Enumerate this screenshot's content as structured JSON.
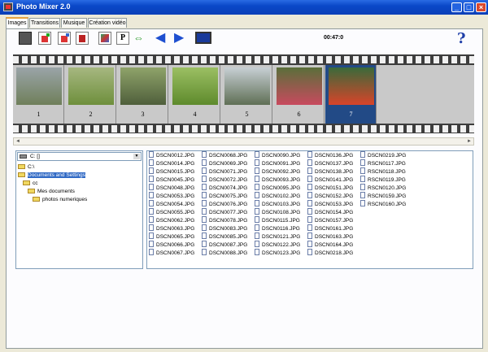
{
  "window": {
    "title": "Photo Mixer  2.0"
  },
  "tabs": [
    {
      "label": "Images",
      "active": true
    },
    {
      "label": "Transitions",
      "active": false
    },
    {
      "label": "Musique",
      "active": false
    },
    {
      "label": "Création vidéo",
      "active": false
    }
  ],
  "toolbar": {
    "timecode": "00:47:0",
    "buttons": [
      "camera-icon",
      "image-add-icon",
      "image-remove-icon",
      "image-delete-icon",
      "image-color-icon",
      "text-p-icon",
      "swap-arrows-icon",
      "arrow-left-icon",
      "arrow-right-icon",
      "monitor-icon"
    ],
    "help": "?"
  },
  "filmstrip": {
    "selected": 7,
    "frames": [
      {
        "number": "1",
        "colors": [
          "#9aa4a8",
          "#6f7f5a"
        ]
      },
      {
        "number": "2",
        "colors": [
          "#a6b780",
          "#6e8f3c"
        ]
      },
      {
        "number": "3",
        "colors": [
          "#8fa36a",
          "#4f5f3c"
        ]
      },
      {
        "number": "4",
        "colors": [
          "#9bbf63",
          "#5e8a2c"
        ]
      },
      {
        "number": "5",
        "colors": [
          "#c7cfd4",
          "#5f6f55"
        ]
      },
      {
        "number": "6",
        "colors": [
          "#5a6f3a",
          "#c84a5e"
        ]
      },
      {
        "number": "7",
        "colors": [
          "#3a6a3a",
          "#d8442a"
        ]
      }
    ]
  },
  "tree": {
    "drive": "C: []",
    "nodes": [
      {
        "label": "C:\\",
        "indent": 0,
        "selected": false
      },
      {
        "label": "Documents and Settings",
        "indent": 0,
        "selected": true
      },
      {
        "label": "cc",
        "indent": 1,
        "selected": false
      },
      {
        "label": "Mes documents",
        "indent": 2,
        "selected": false
      },
      {
        "label": "photos numeriques",
        "indent": 3,
        "selected": false
      }
    ]
  },
  "files": {
    "columns": [
      [
        "DSCN0012.JPG",
        "DSCN0014.JPG",
        "DSCN0015.JPG",
        "DSCN0045.JPG",
        "DSCN0048.JPG",
        "DSCN0053.JPG",
        "DSCN0054.JPG",
        "DSCN0055.JPG",
        "DSCN0062.JPG",
        "DSCN0063.JPG",
        "DSCN0065.JPG",
        "DSCN0066.JPG",
        "DSCN0067.JPG"
      ],
      [
        "DSCN0068.JPG",
        "DSCN0069.JPG",
        "DSCN0071.JPG",
        "DSCN0072.JPG",
        "DSCN0074.JPG",
        "DSCN0075.JPG",
        "DSCN0076.JPG",
        "DSCN0077.JPG",
        "DSCN0078.JPG",
        "DSCN0083.JPG",
        "DSCN0085.JPG",
        "DSCN0087.JPG",
        "DSCN0088.JPG"
      ],
      [
        "DSCN0090.JPG",
        "DSCN0091.JPG",
        "DSCN0092.JPG",
        "DSCN0093.JPG",
        "DSCN0095.JPG",
        "DSCN0102.JPG",
        "DSCN0103.JPG",
        "DSCN0108.JPG",
        "DSCN0115.JPG",
        "DSCN0116.JPG",
        "DSCN0121.JPG",
        "DSCN0122.JPG",
        "DSCN0123.JPG"
      ],
      [
        "DSCN0136.JPG",
        "DSCN0137.JPG",
        "DSCN0138.JPG",
        "DSCN0141.JPG",
        "DSCN0151.JPG",
        "DSCN0152.JPG",
        "DSCN0153.JPG",
        "DSCN0154.JPG",
        "DSCN0157.JPG",
        "DSCN0161.JPG",
        "DSCN0163.JPG",
        "DSCN0164.JPG",
        "DSCN0218.JPG"
      ],
      [
        "DSCN0219.JPG",
        "RSCN0117.JPG",
        "RSCN0118.JPG",
        "RSCN0119.JPG",
        "RSCN0120.JPG",
        "RSCN0159.JPG",
        "RSCN0160.JPG"
      ]
    ]
  }
}
